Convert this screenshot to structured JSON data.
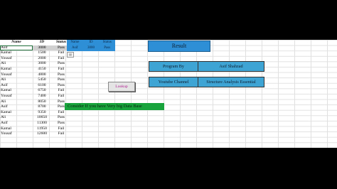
{
  "columns": {
    "name": "Name",
    "id": "ID",
    "status": "Status"
  },
  "rows": [
    {
      "name": "Asif",
      "id": "3000",
      "status": "Pass"
    },
    {
      "name": "Kamal",
      "id": "1500",
      "status": "Fail"
    },
    {
      "name": "Yousaf",
      "id": "2000",
      "status": "Fail"
    },
    {
      "name": "Ali",
      "id": "3000",
      "status": "Pass"
    },
    {
      "name": "Kamal",
      "id": "4150",
      "status": "Fail"
    },
    {
      "name": "Yousaf",
      "id": "4800",
      "status": "Pass"
    },
    {
      "name": "Ali",
      "id": "5450",
      "status": "Pass"
    },
    {
      "name": "Asif",
      "id": "6100",
      "status": "Pass"
    },
    {
      "name": "Kamal",
      "id": "6750",
      "status": "Fail"
    },
    {
      "name": "Yousaf",
      "id": "7400",
      "status": "Fail"
    },
    {
      "name": "Ali",
      "id": "8050",
      "status": "Pass"
    },
    {
      "name": "Asif",
      "id": "8700",
      "status": "Pass"
    },
    {
      "name": "Kamal",
      "id": "9350",
      "status": "Fail"
    },
    {
      "name": "Ali",
      "id": "10650",
      "status": "Pass"
    },
    {
      "name": "Asif",
      "id": "11300",
      "status": "Pass"
    },
    {
      "name": "Kamal",
      "id": "11950",
      "status": "Fail"
    },
    {
      "name": "Yousaf",
      "id": "12600",
      "status": "Fail"
    }
  ],
  "lookup_table": {
    "headers": [
      "Name",
      "ID",
      "Status"
    ],
    "row": [
      "Asif",
      "3000",
      "Pass"
    ]
  },
  "result_label": "Result",
  "program_by_label": "Program By",
  "program_by_value": "Asif Shahzad",
  "channel_label": "Youtube Channel",
  "channel_value": "Structure Analysis Essential",
  "lookup_button": "Lookup",
  "banner_text": "Consider If you have Very big Data Base",
  "colors": {
    "accent_blue": "#2e8fd6",
    "banner_green": "#18a33c",
    "button_text": "#b0198f"
  }
}
